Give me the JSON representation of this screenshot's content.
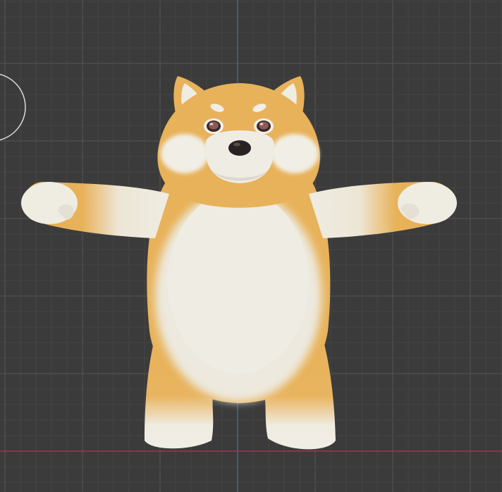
{
  "viewport": {
    "kind": "3d-viewport",
    "colors": {
      "background": "#3b3b3b",
      "grid_minor": "#454545",
      "grid_major": "#505050",
      "axis_x": "#9a3a48",
      "axis_y": "#4a6fa0",
      "cursor": "#e6e6e6"
    }
  },
  "model": {
    "subject": "shiba-inu",
    "pose": "t-pose",
    "colors": {
      "fur_orange": "#e8b25a",
      "fur_cream": "#efece2",
      "fur_cream_shade": "#dcd8cc",
      "nose": "#2a2222",
      "eye": "#8a5a55",
      "eye_rim": "#3a2626"
    }
  }
}
